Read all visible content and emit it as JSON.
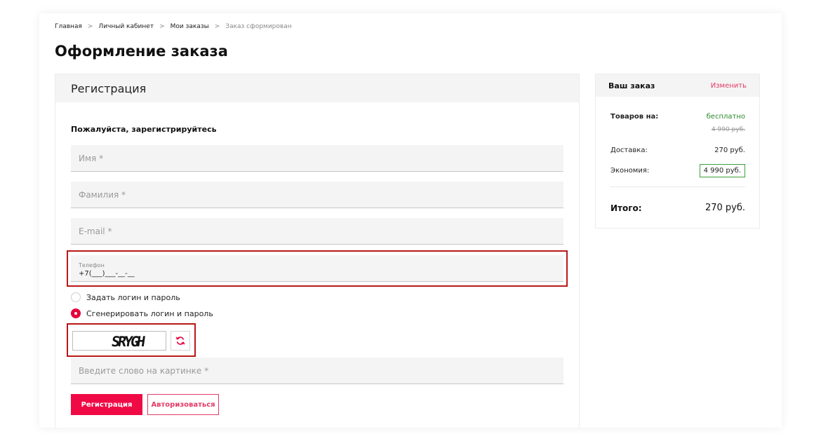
{
  "breadcrumb": {
    "items": [
      "Главная",
      "Личный кабинет",
      "Мои заказы"
    ],
    "current": "Заказ сформирован",
    "separator": ">"
  },
  "page": {
    "title": "Оформление заказа"
  },
  "registration": {
    "title": "Регистрация",
    "subtitle": "Пожалуйста, зарегистрируйтесь",
    "fields": {
      "first_name_placeholder": "Имя *",
      "last_name_placeholder": "Фамилия *",
      "email_placeholder": "E-mail *",
      "phone_label": "Телефон",
      "phone_value": "+7(___)___-__-__"
    },
    "login_options": {
      "set_login": "Задать логин и пароль",
      "generate_login": "Сгенерировать логин и пароль",
      "selected": "generate_login"
    },
    "captcha": {
      "image_text": "SRYGH",
      "input_placeholder": "Введите слово на картинке *",
      "refresh_icon": "refresh-icon"
    },
    "buttons": {
      "register": "Регистрация",
      "login": "Авторизоваться"
    }
  },
  "order": {
    "title": "Ваш заказ",
    "edit_label": "Изменить",
    "goods_label": "Товаров на:",
    "goods_value": "бесплатно",
    "goods_old_value": "4 990 руб.",
    "delivery_label": "Доставка:",
    "delivery_value": "270 руб.",
    "savings_label": "Экономия:",
    "savings_value": "4 990 руб.",
    "total_label": "Итого:",
    "total_value": "270 руб."
  },
  "colors": {
    "accent": "#f00a45",
    "highlight_border": "#b81818",
    "savings_border": "#3aa03a",
    "free_text": "#2a8a2a"
  }
}
